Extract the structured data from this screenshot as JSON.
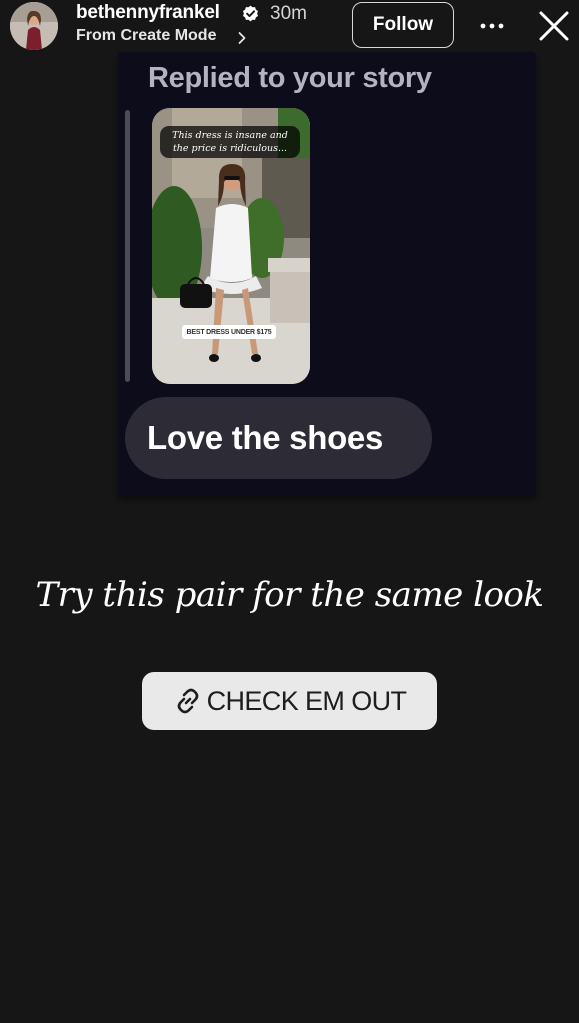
{
  "header": {
    "username": "bethennyfrankel",
    "timestamp": "30m",
    "subtitle": "From Create Mode",
    "follow_label": "Follow"
  },
  "reply_card": {
    "heading": "Replied to your story",
    "story": {
      "caption": "This dress is insane and the price is ridiculous...",
      "link_sticker": "BEST DRESS UNDER $175"
    },
    "message": "Love the shoes"
  },
  "overlay": {
    "script_text": "Try this pair for the same look",
    "link_label": "CHECK EM OUT"
  },
  "icons": {
    "verified": "verified-badge-icon",
    "chevron": "chevron-right-icon",
    "more": "more-options-icon",
    "close": "close-icon",
    "link": "link-icon"
  },
  "colors": {
    "background": "#161616",
    "card_background": "#0d0c1a",
    "bubble_background": "#2c2b36",
    "sticker_background": "#e9e9e9"
  }
}
